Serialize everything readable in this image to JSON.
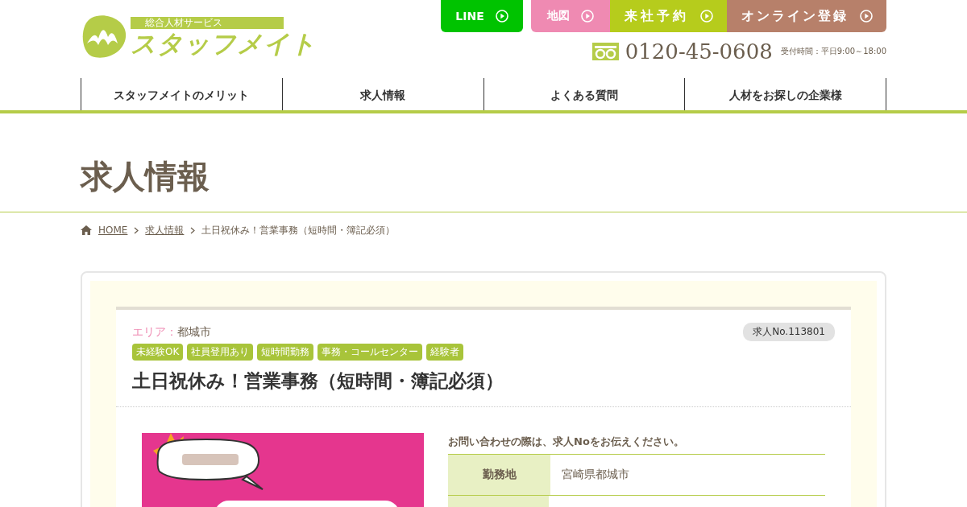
{
  "logo": {
    "tagline": "総合人材サービス",
    "name": "スタッフメイト"
  },
  "header_buttons": [
    {
      "label": "LINE",
      "kind": "line"
    },
    {
      "label": "地図",
      "kind": "map"
    },
    {
      "label": "来社予約",
      "kind": "visit"
    },
    {
      "label": "オンライン登録",
      "kind": "online"
    }
  ],
  "phone": {
    "number": "0120-45-0608",
    "hours": "受付時間：平日9:00～18:00"
  },
  "nav": [
    "スタッフメイトのメリット",
    "求人情報",
    "よくある質問",
    "人材をお探しの企業様"
  ],
  "page_title": "求人情報",
  "breadcrumb": [
    {
      "label": "HOME",
      "link": true
    },
    {
      "label": "求人情報",
      "link": true
    },
    {
      "label": "土日祝休み！営業事務（短時間・簿記必須）",
      "link": false
    }
  ],
  "job": {
    "area_label": "エリア：",
    "area": "都城市",
    "job_no": "求人No.113801",
    "tags": [
      "未経験OK",
      "社員登用あり",
      "短時間勤務",
      "事務・コールセンター",
      "経験者"
    ],
    "title": "土日祝休み！営業事務（短時間・簿記必須）",
    "notice": "お問い合わせの際は、求人Noをお伝えください。",
    "details": [
      {
        "label": "勤務地",
        "value": "宮崎県都城市"
      }
    ]
  }
}
